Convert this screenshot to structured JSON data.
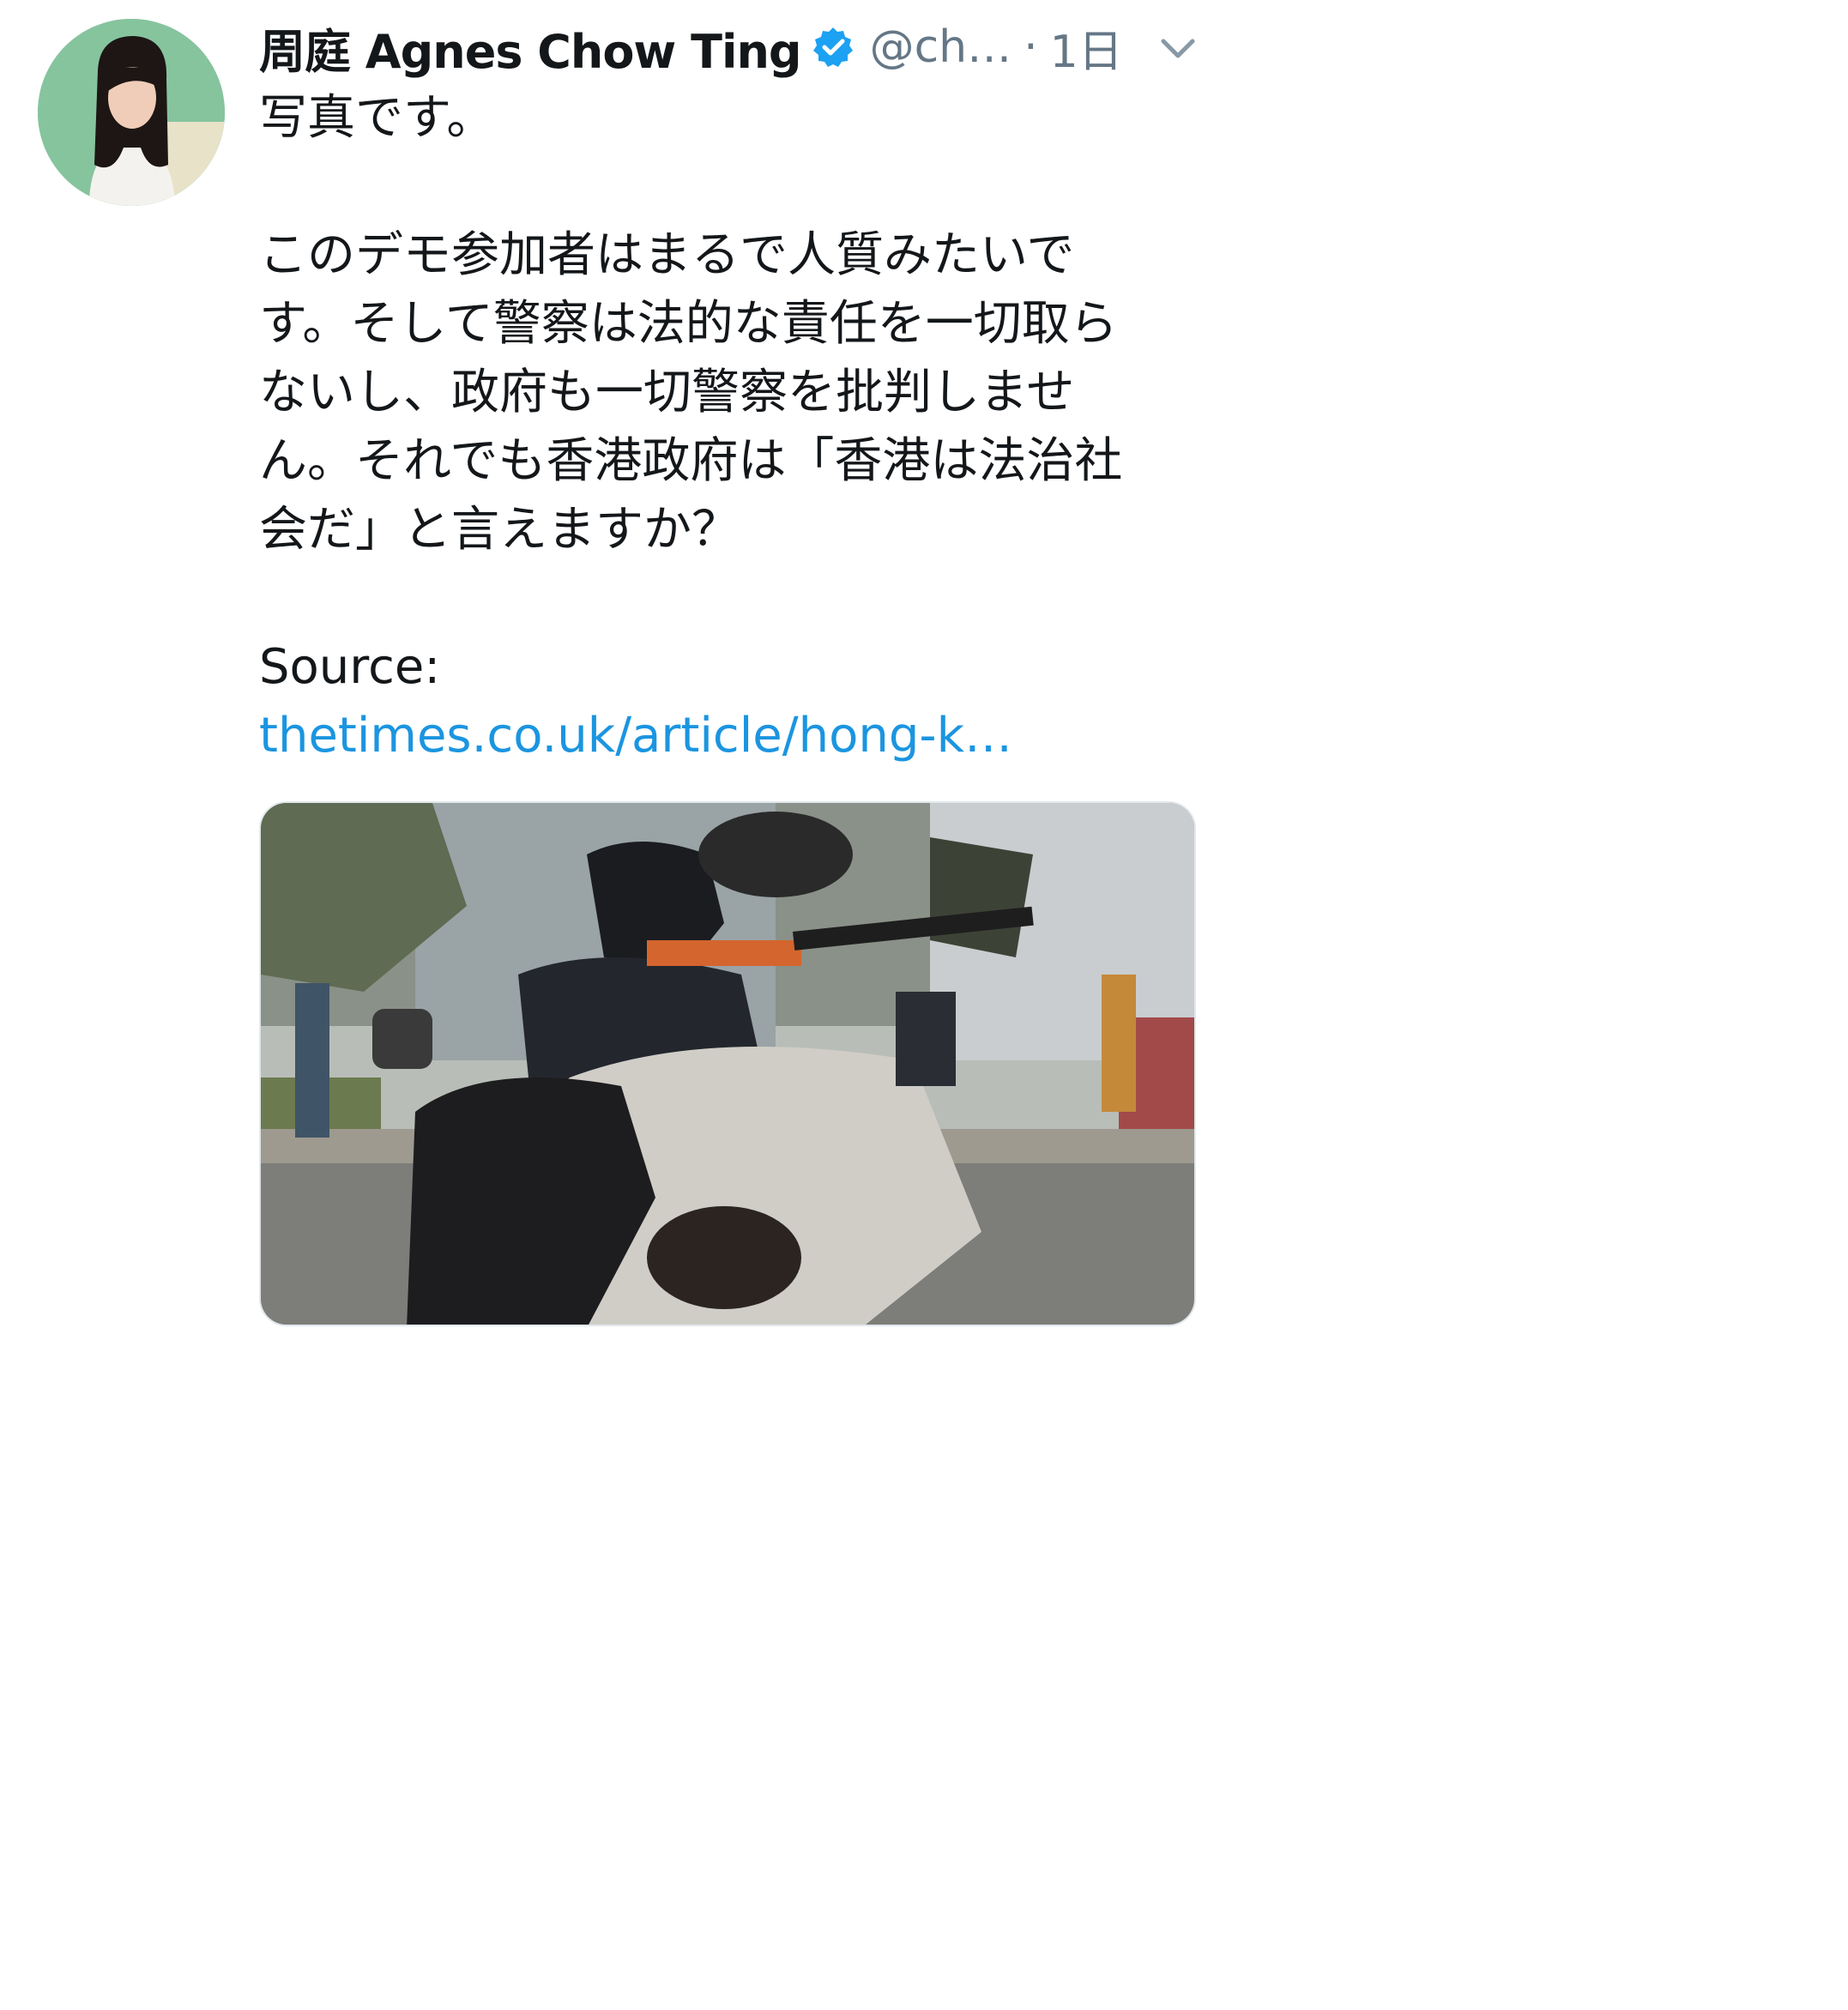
{
  "tweet": {
    "display_name": "周庭 Agnes Chow Ting",
    "handle": "@ch…",
    "separator": "·",
    "timestamp": "1日",
    "text_line1": "写真です。",
    "text_para2": "このデモ参加者はまるで人質みたいで\nす。そして警察は法的な責任を一切取ら\nないし、政府も一切警察を批判しませ\nん。それでも香港政府は「香港は法治社\n会だ」と言えますか？",
    "source_label": "Source:",
    "source_link": "thetimes.co.uk/article/hong-k…"
  },
  "icons": {
    "verified": "verified-badge-icon",
    "caret": "chevron-down-icon"
  },
  "colors": {
    "text": "#14171a",
    "muted": "#657786",
    "link": "#1b95e0",
    "verified": "#1da1f2"
  }
}
